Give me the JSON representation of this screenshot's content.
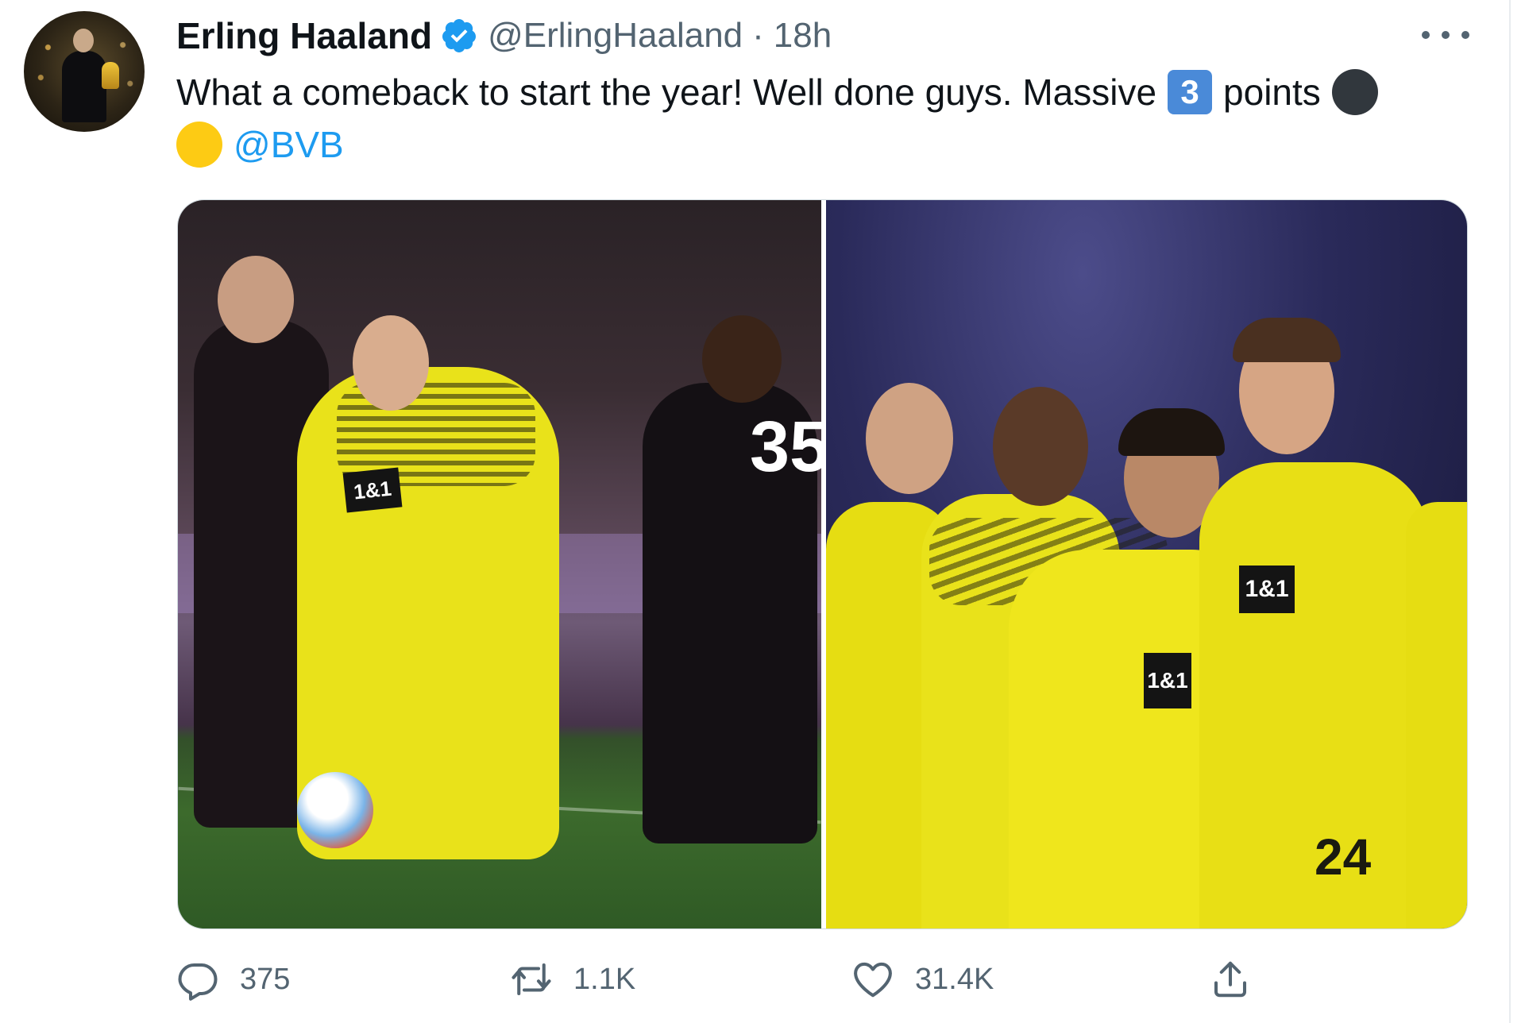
{
  "tweet": {
    "author_name": "Erling Haaland",
    "handle": "@ErlingHaaland",
    "separator": "·",
    "time": "18h",
    "text_part1": "What a comeback to start the year! Well done guys. Massive",
    "emoji_number": "3",
    "text_part2": "points",
    "mention": "@BVB",
    "photo_left_shirt_number": "35",
    "photo_left_sponsor": "1&1",
    "photo_right_sponsor": "1&1",
    "photo_right_shirt_number": "24"
  },
  "actions": {
    "reply_count": "375",
    "retweet_count": "1.1K",
    "like_count": "31.4K"
  },
  "icons": {
    "verified": "verified-badge-icon",
    "more": "more-options-icon",
    "reply": "reply-icon",
    "retweet": "retweet-icon",
    "like": "heart-icon",
    "share": "share-icon"
  },
  "colors": {
    "accent": "#1d9bf0",
    "text_primary": "#0f1419",
    "text_secondary": "#536471",
    "emoji_black_circle": "#31373d",
    "emoji_yellow_circle": "#fdcb14",
    "emoji_keycap": "#4a8ad8"
  }
}
